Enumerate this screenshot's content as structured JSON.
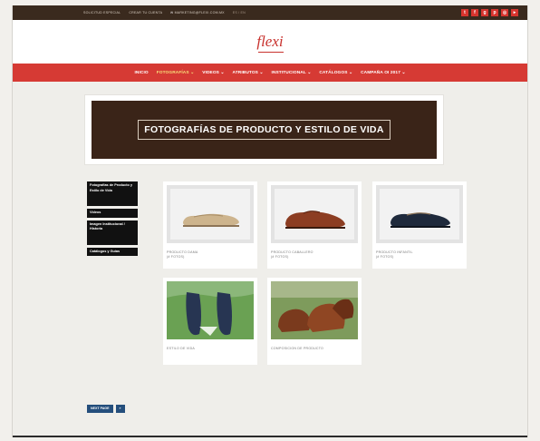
{
  "topbar": {
    "items": [
      "SOLICITUD ESPECIAL",
      "CREAR TU CUENTA",
      "MARKETING@FLEXI.COM.MX",
      "ES / EN"
    ],
    "social_icons": [
      "twitter-icon",
      "facebook-icon",
      "googleplus-icon",
      "pinterest-icon",
      "instagram-icon",
      "youtube-icon"
    ]
  },
  "logo": {
    "text": "flexi"
  },
  "nav": {
    "items": [
      "INICIO",
      "FOTOGRAFÍAS ⌄",
      "VIDEOS ⌄",
      "ATRIBUTOS ⌄",
      "INSTITUCIONAL ⌄",
      "CATÁLOGOS ⌄",
      "CAMPAÑA OI 2017 ⌄"
    ],
    "active_index": 1
  },
  "hero": {
    "title": "FOTOGRAFÍAS DE PRODUCTO Y ESTILO DE VIDA"
  },
  "sidebar": {
    "items": [
      "Fotografías de Producto y Estilo de Vida",
      "Videos",
      "Imagen Institucional / Historia",
      "Catálogos y Guías"
    ]
  },
  "gallery": {
    "cards": [
      {
        "title": "PRODUCTO DAMA",
        "subtitle": "(# FOTOS)",
        "image": "beige-loafer-photo"
      },
      {
        "title": "PRODUCTO CABALLERO",
        "subtitle": "(# FOTOS)",
        "image": "brown-oxford-photo"
      },
      {
        "title": "PRODUCTO INFANTIL",
        "subtitle": "(# FOTOS)",
        "image": "navy-loafer-photo"
      },
      {
        "title": "ESTILO DE VIDA",
        "subtitle": "",
        "image": "feet-in-shoes-photo"
      },
      {
        "title": "COMPOSICION DE PRODUCTO",
        "subtitle": "",
        "image": "boots-on-grass-photo"
      }
    ]
  },
  "pager": {
    "next_label": "NEXT PAGE",
    "arrow": "»"
  },
  "colors": {
    "brand_red": "#d63a34",
    "dark_brown": "#3a2418",
    "pager_blue": "#244e7c"
  }
}
